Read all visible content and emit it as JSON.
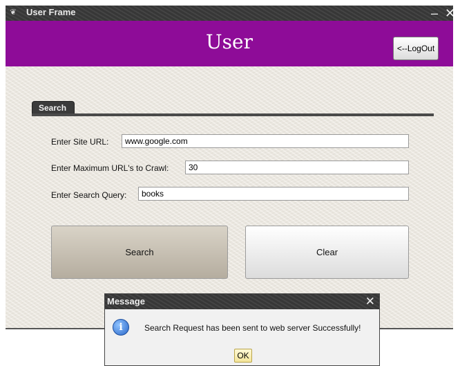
{
  "window": {
    "title": "User Frame",
    "minimize_glyph": "–",
    "close_glyph": "✕"
  },
  "header": {
    "heading": "User",
    "logout_label": "<--LogOut",
    "color": "#8e0c98"
  },
  "tab": {
    "label": "Search"
  },
  "form": {
    "site_url_label": "Enter Site URL:",
    "site_url_value": "www.google.com",
    "max_urls_label": "Enter Maximum URL's to Crawl:",
    "max_urls_value": "30",
    "query_label": "Enter Search Query:",
    "query_value": "books"
  },
  "buttons": {
    "search_label": "Search",
    "clear_label": "Clear"
  },
  "dialog": {
    "title": "Message",
    "close_glyph": "✕",
    "message": "Search Request has been sent to web server Successfully!",
    "ok_label": "OK",
    "icon": "info-icon"
  }
}
